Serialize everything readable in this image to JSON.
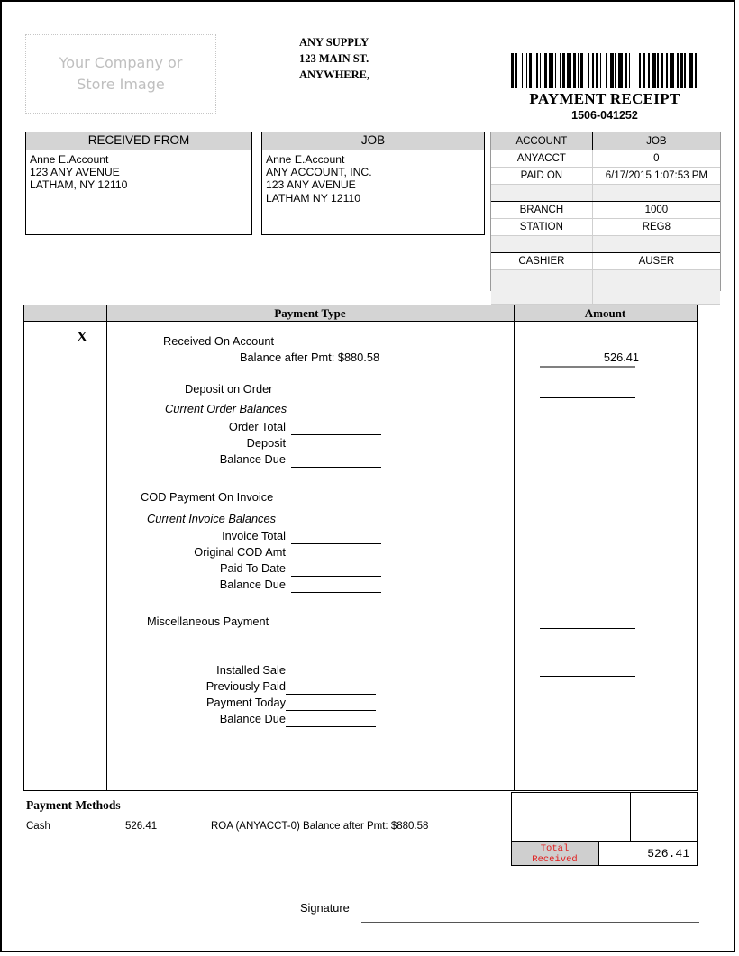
{
  "logo": {
    "placeholder_line1": "Your Company or",
    "placeholder_line2": "Store Image"
  },
  "company": {
    "name": "ANY SUPPLY",
    "street": "123 MAIN ST.",
    "city": "ANYWHERE,"
  },
  "receipt": {
    "title": "PAYMENT RECEIPT",
    "number": "1506-041252"
  },
  "received_from": {
    "header": "RECEIVED FROM",
    "lines": [
      "Anne E.Account",
      "123 ANY AVENUE",
      "LATHAM, NY  12110"
    ]
  },
  "job": {
    "header": "JOB",
    "lines": [
      "Anne E.Account",
      "ANY ACCOUNT, INC.",
      "123 ANY AVENUE",
      "LATHAM  NY  12110"
    ]
  },
  "info": {
    "col_headers": [
      "ACCOUNT",
      "JOB"
    ],
    "rows": [
      {
        "key": "ANYACCT",
        "value": "0"
      },
      {
        "key": "PAID ON",
        "value": "6/17/2015 1:07:53 PM"
      },
      {
        "key": "",
        "value": ""
      },
      {
        "key": "BRANCH",
        "value": "1000"
      },
      {
        "key": "STATION",
        "value": "REG8"
      },
      {
        "key": "",
        "value": ""
      },
      {
        "key": "CASHIER",
        "value": "AUSER"
      },
      {
        "key": "",
        "value": ""
      },
      {
        "key": "",
        "value": ""
      }
    ]
  },
  "payment_table": {
    "headers": {
      "check": "",
      "type": "Payment Type",
      "amount": "Amount"
    },
    "checked_mark": "X",
    "sections": {
      "roa": {
        "title": "Received On Account",
        "subtitle": "Balance after Pmt: $880.58",
        "amount": "526.41"
      },
      "deposit_on_order": {
        "title": "Deposit on Order",
        "group_label": "Current Order Balances",
        "fields": [
          "Order Total",
          "Deposit",
          "Balance Due"
        ],
        "amount": ""
      },
      "cod": {
        "title": "COD Payment On Invoice",
        "group_label": "Current Invoice Balances",
        "fields": [
          "Invoice Total",
          "Original COD Amt",
          "Paid To Date",
          "Balance Due"
        ],
        "amount": ""
      },
      "misc": {
        "title": "Miscellaneous Payment",
        "amount": ""
      },
      "installed": {
        "fields": [
          "Installed Sale",
          "Previously Paid",
          "Payment Today",
          "Balance Due"
        ],
        "amount": ""
      }
    }
  },
  "payment_methods": {
    "title": "Payment Methods",
    "rows": [
      {
        "method": "Cash",
        "amount": "526.41",
        "note": "ROA (ANYACCT-0) Balance after Pmt: $880.58"
      }
    ]
  },
  "total": {
    "label_line1": "Total",
    "label_line2": "Received",
    "value": "526.41",
    "color": "#e01b1b"
  },
  "signature": {
    "label": "Signature"
  }
}
